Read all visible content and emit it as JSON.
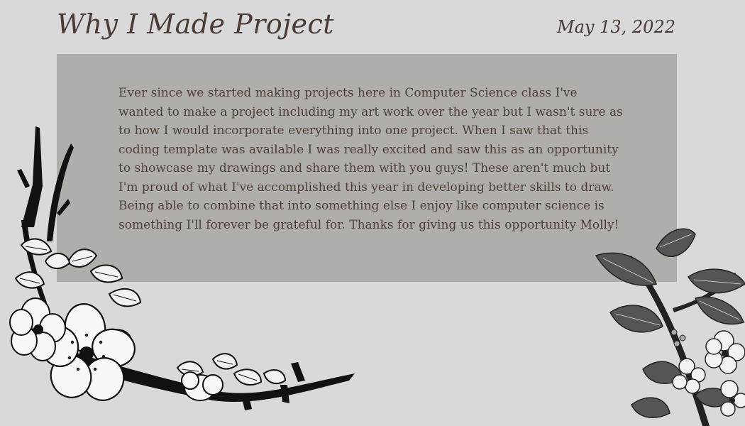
{
  "slide": {
    "title": "Why I Made Project",
    "date": "May 13, 2022",
    "body": "Ever since we started making projects here in Computer Science class I've wanted to make a project including my art work over the year but I wasn't sure as to how I would incorporate everything into one project. When I saw that this coding template was available I was really excited and saw this as an opportunity to showcase my drawings and share them with you guys! These aren't much but I'm proud of what I've accomplished this year in developing better skills to draw. Being able to combine that into something else I enjoy like computer science is something I'll forever be grateful for. Thanks for giving us this opportunity Molly!"
  },
  "colors": {
    "background": "#d9d9d9",
    "panel": "#b0aeab",
    "text": "#4e3f37",
    "heading": "#4a3b34"
  },
  "decorations": [
    "floral-branch-left-icon",
    "leaf-branch-right-icon"
  ]
}
